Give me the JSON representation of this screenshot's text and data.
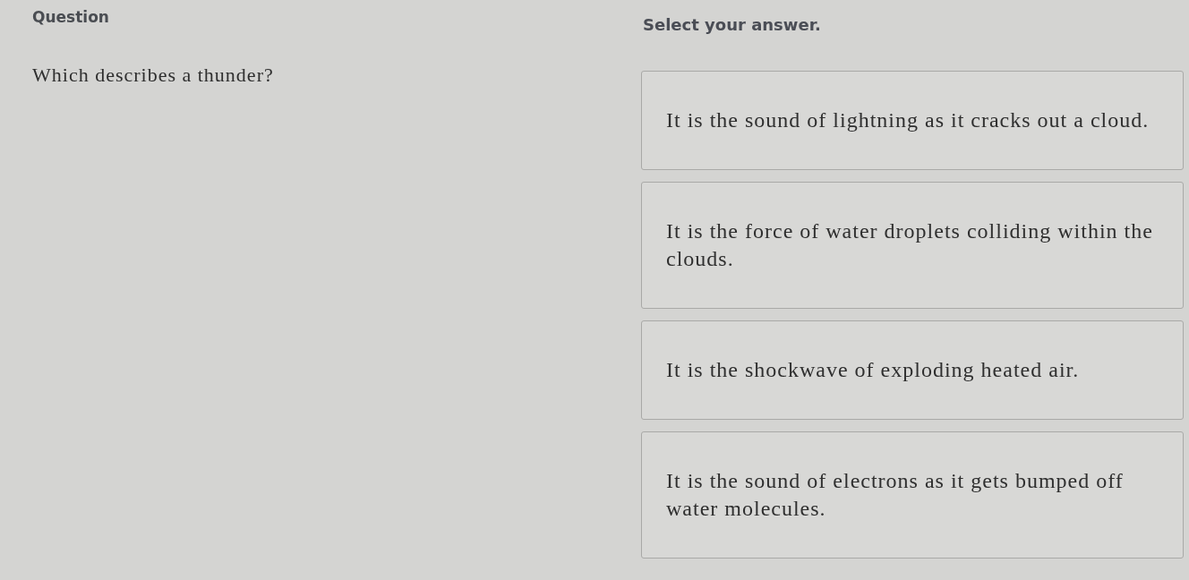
{
  "question_panel": {
    "heading": "Question",
    "prompt": "Which describes a thunder?"
  },
  "answer_panel": {
    "instruction": "Select your answer.",
    "options": [
      {
        "text": "It is the sound of lightning as it cracks out a cloud.",
        "selected": false
      },
      {
        "text": "It is the force of water droplets colliding within the clouds.",
        "selected": false
      },
      {
        "text": "It is the shockwave of exploding heated air.",
        "selected": false
      },
      {
        "text": "It is the sound of electrons as it gets bumped off water molecules.",
        "selected": false
      }
    ]
  }
}
